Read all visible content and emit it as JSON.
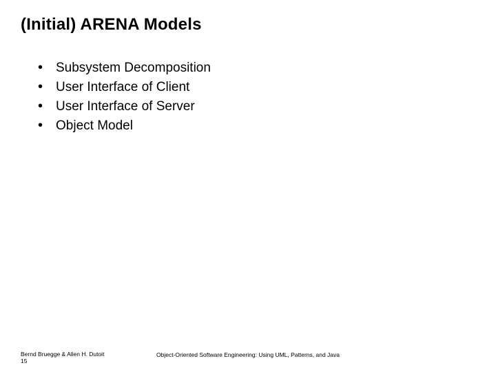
{
  "title": "(Initial) ARENA Models",
  "bullets": [
    "Subsystem Decomposition",
    "User Interface of Client",
    "User Interface of Server",
    "Object Model"
  ],
  "footer": {
    "authors": "Bernd Bruegge & Allen H. Dutoit",
    "page_number": "15",
    "book_title": "Object-Oriented Software Engineering: Using UML, Patterns, and Java"
  }
}
